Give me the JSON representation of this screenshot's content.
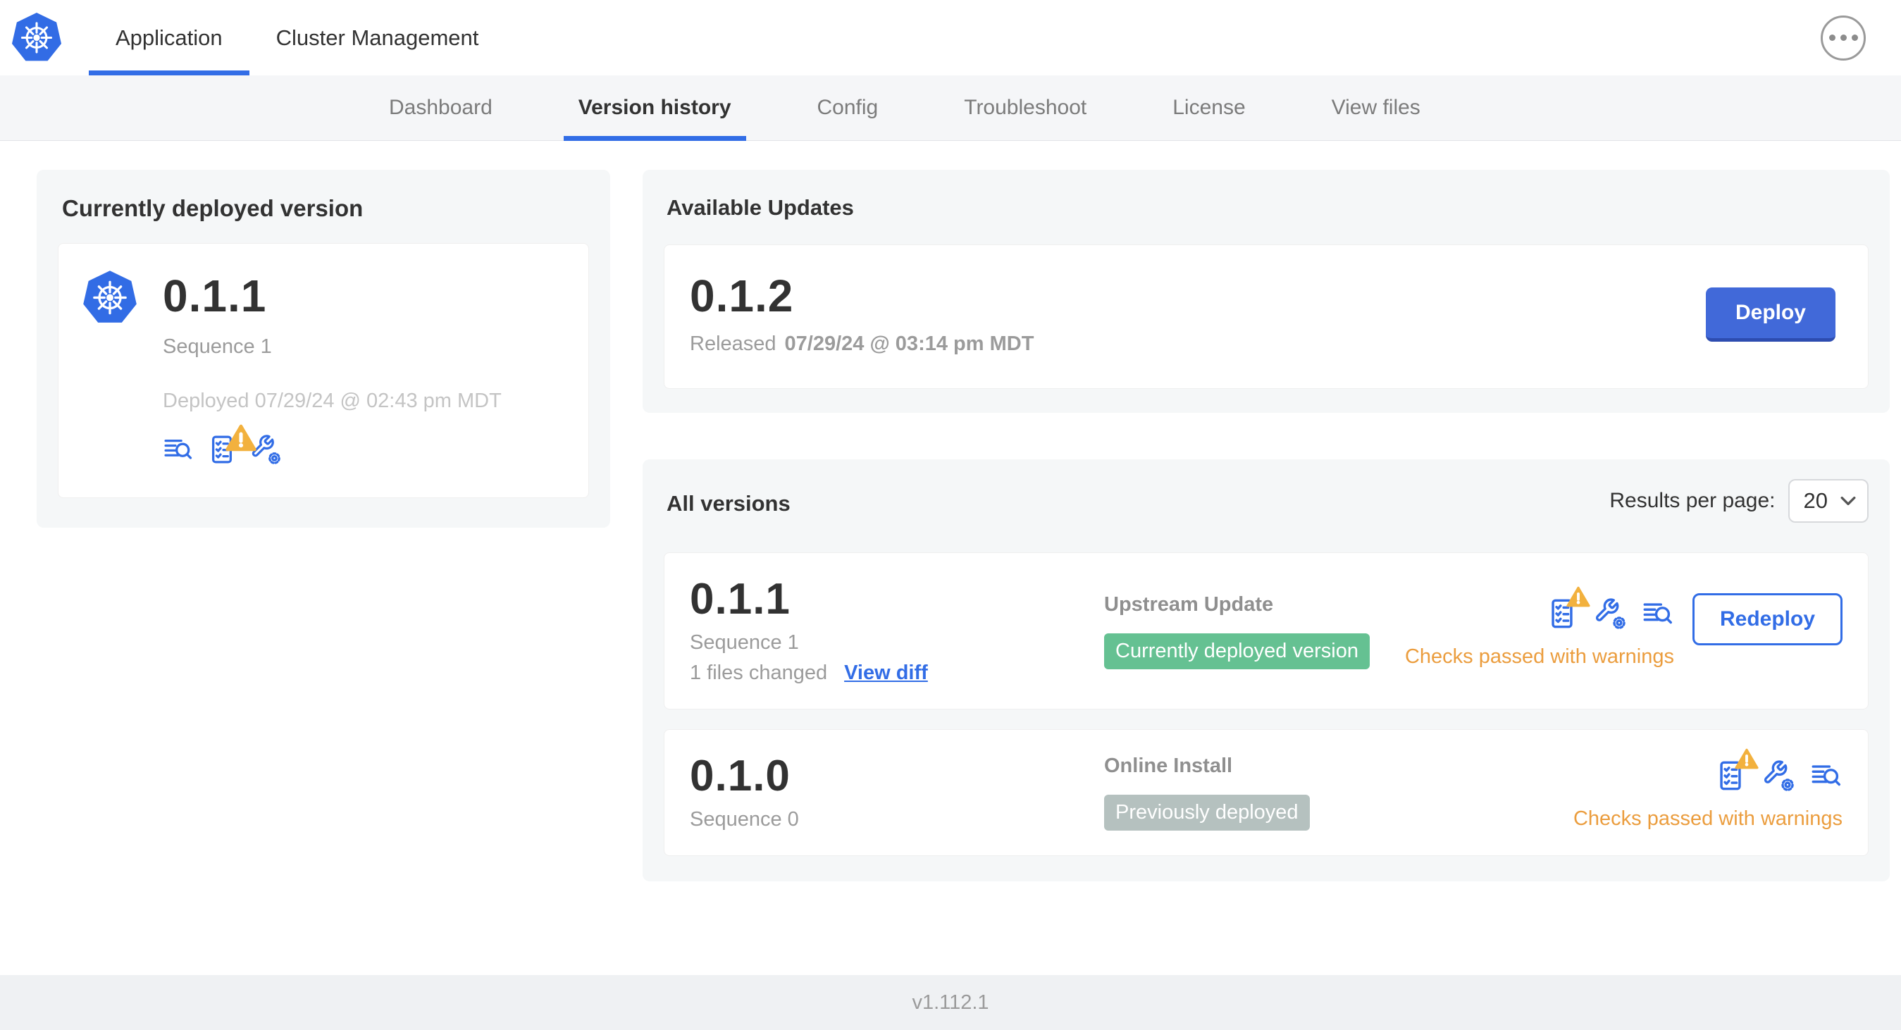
{
  "topnav": {
    "tabs": [
      {
        "label": "Application",
        "active": true
      },
      {
        "label": "Cluster Management",
        "active": false
      }
    ],
    "overflow_menu_icon": "ellipsis-icon",
    "logo_icon": "kubernetes-logo"
  },
  "subnav": {
    "tabs": [
      {
        "label": "Dashboard",
        "active": false
      },
      {
        "label": "Version history",
        "active": true
      },
      {
        "label": "Config",
        "active": false
      },
      {
        "label": "Troubleshoot",
        "active": false
      },
      {
        "label": "License",
        "active": false
      },
      {
        "label": "View files",
        "active": false
      }
    ]
  },
  "current_version": {
    "title": "Currently deployed version",
    "app_icon": "kubernetes-logo",
    "version": "0.1.1",
    "sequence": "Sequence 1",
    "deployed": "Deployed 07/29/24 @ 02:43 pm MDT",
    "icons": [
      "version-diff-icon",
      "preflight-checks-warning-icon",
      "config-icon"
    ]
  },
  "available_updates": {
    "title": "Available Updates",
    "version": "0.1.2",
    "released_label": "Released",
    "released_date": "07/29/24 @ 03:14 pm MDT",
    "deploy_label": "Deploy"
  },
  "all_versions": {
    "title": "All versions",
    "results_per_page_label": "Results per page:",
    "results_per_page_value": "20",
    "rows": [
      {
        "version": "0.1.1",
        "sequence": "Sequence 1",
        "files_changed": "1 files changed",
        "view_diff_label": "View diff",
        "source": "Upstream Update",
        "status_badge": "Currently deployed version",
        "status_badge_color": "#65c192",
        "icons": [
          "preflight-checks-warning-icon",
          "config-icon",
          "version-diff-icon"
        ],
        "checks_text": "Checks passed with warnings",
        "action_label": "Redeploy"
      },
      {
        "version": "0.1.0",
        "sequence": "Sequence 0",
        "source": "Online Install",
        "status_badge": "Previously deployed",
        "status_badge_color": "#b5c1bf",
        "icons": [
          "preflight-checks-warning-icon",
          "config-icon",
          "version-diff-icon"
        ],
        "checks_text": "Checks passed with warnings"
      }
    ]
  },
  "footer": {
    "version": "v1.112.1"
  },
  "colors": {
    "accent_blue": "#326de6",
    "button_blue": "#4169d9",
    "warning_orange": "#eb9d3e",
    "warning_triangle": "#f2b13e",
    "badge_green": "#65c192",
    "badge_gray": "#b5c1bf",
    "subnav_bg": "#f5f6f8",
    "card_bg": "#f5f7f8",
    "footer_bg": "#eff1f3"
  }
}
